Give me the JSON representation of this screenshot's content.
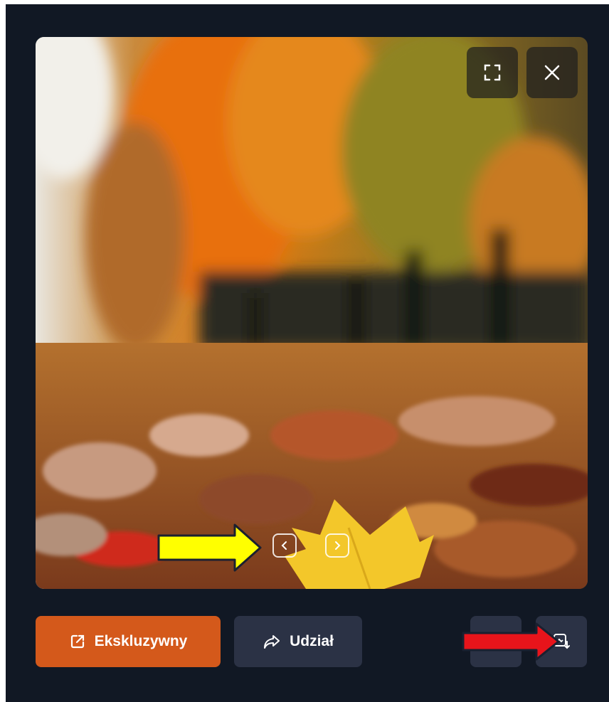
{
  "viewer": {
    "fullscreen_icon": "expand-icon",
    "close_icon": "close-icon",
    "prev_icon": "chevron-left-icon",
    "next_icon": "chevron-right-icon"
  },
  "actions": {
    "exclusive_label": "Ekskluzywny",
    "share_label": "Udział",
    "exclusive_color": "#d4591b",
    "secondary_color": "#2b3245"
  },
  "annotations": {
    "yellow_arrow_color": "#ffff00",
    "red_arrow_color": "#e8141b"
  }
}
